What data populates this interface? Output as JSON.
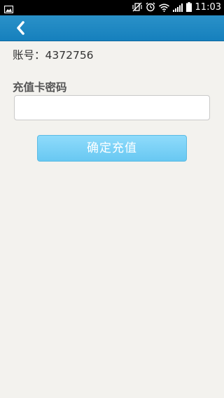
{
  "status_bar": {
    "time": "11:03",
    "icons": [
      "image-notification-icon",
      "vibrate-off-icon",
      "alarm-clock-icon",
      "wifi-icon",
      "signal-icon",
      "battery-icon"
    ]
  },
  "nav": {
    "back_icon": "back-chevron-icon"
  },
  "account": {
    "label": "账号：",
    "value": "4372756"
  },
  "recharge": {
    "card_password_label": "充值卡密码",
    "card_password_value": "",
    "confirm_button": "确定充值"
  },
  "colors": {
    "nav_bar": "#1a84c0",
    "status_bar": "#000000",
    "background": "#f3f2ee",
    "button": "#78d0f6"
  }
}
